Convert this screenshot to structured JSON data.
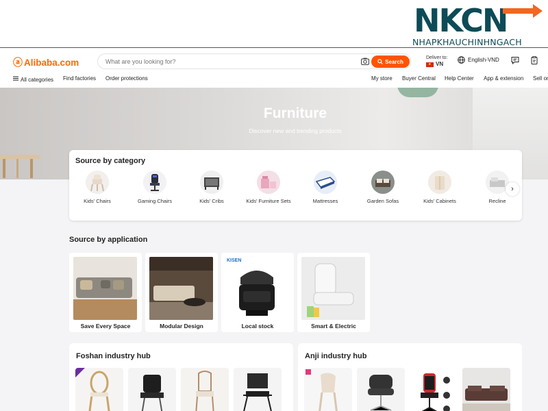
{
  "watermark": {
    "brand": "NKCN",
    "tagline": "NHAPKHAUCHINHNGACH"
  },
  "header": {
    "logo_text": "Alibaba.com",
    "search_placeholder": "What are you looking for?",
    "search_button": "Search",
    "deliver_label": "Deliver to:",
    "deliver_country": "VN",
    "language": "English-VND"
  },
  "nav": {
    "all_categories": "All categories",
    "find_factories": "Find factories",
    "order_protections": "Order protections",
    "my_store": "My store",
    "buyer_central": "Buyer Central",
    "help_center": "Help Center",
    "app_extension": "App & extension",
    "sell_on": "Sell on"
  },
  "hero": {
    "title": "Furniture",
    "subtitle": "Discover new and trending products"
  },
  "categories": {
    "title": "Source by category",
    "items": [
      {
        "label": "Kids' Chairs"
      },
      {
        "label": "Gaming Chairs"
      },
      {
        "label": "Kids' Cribs"
      },
      {
        "label": "Kids' Furniture Sets"
      },
      {
        "label": "Mattresses"
      },
      {
        "label": "Garden Sofas"
      },
      {
        "label": "Kids' Cabinets"
      },
      {
        "label": "Recline"
      }
    ]
  },
  "applications": {
    "title": "Source by application",
    "items": [
      {
        "label": "Save Every Space"
      },
      {
        "label": "Modular Design"
      },
      {
        "label": "Local stock",
        "brand_mark": "KISEN"
      },
      {
        "label": "Smart & Electric"
      }
    ]
  },
  "hubs": [
    {
      "title": "Foshan industry hub"
    },
    {
      "title": "Anji industry hub"
    }
  ],
  "colors": {
    "accent": "#ff5400",
    "brand": "#ff6a00",
    "watermark": "#0c4b57",
    "watermark_arrow": "#f26722"
  }
}
